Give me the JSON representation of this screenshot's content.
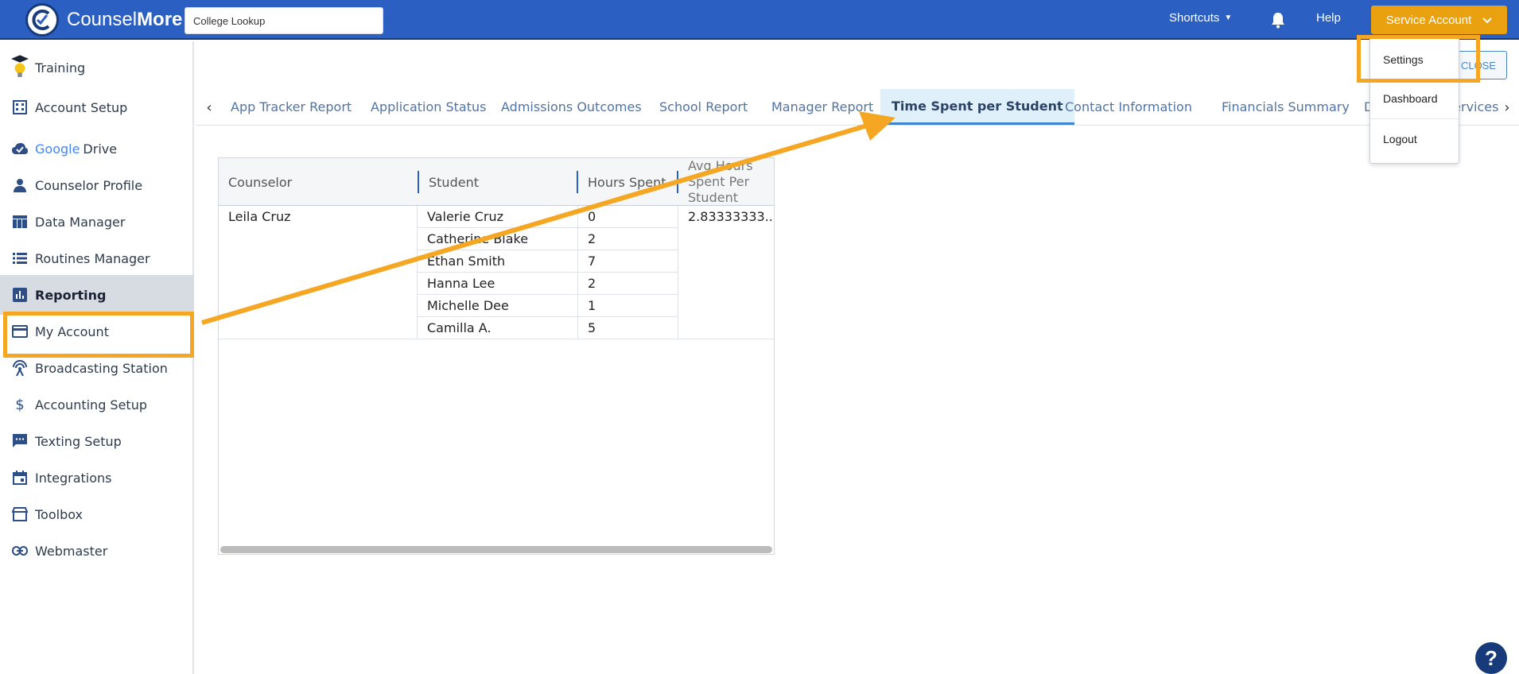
{
  "header": {
    "brand_light": "Counsel",
    "brand_bold": "More",
    "search_value": "College Lookup",
    "shortcuts_label": "Shortcuts",
    "help_label": "Help",
    "account_label": "Service Account"
  },
  "sidebar": {
    "items": [
      {
        "label": "Training"
      },
      {
        "label": "Account Setup"
      },
      {
        "label_google": "Google",
        "label": "Drive"
      },
      {
        "label": "Counselor Profile"
      },
      {
        "label": "Data Manager"
      },
      {
        "label": "Routines Manager"
      },
      {
        "label": "Reporting"
      },
      {
        "label": "My Account"
      },
      {
        "label": "Broadcasting Station"
      },
      {
        "label": "Accounting Setup"
      },
      {
        "label": "Texting Setup"
      },
      {
        "label": "Integrations"
      },
      {
        "label": "Toolbox"
      },
      {
        "label": "Webmaster"
      }
    ]
  },
  "main": {
    "close_label": "CLOSE",
    "tabs": [
      {
        "label": "App Tracker Report"
      },
      {
        "label": "Application Status"
      },
      {
        "label": "Admissions Outcomes"
      },
      {
        "label": "School Report"
      },
      {
        "label": "Manager Report"
      },
      {
        "label": "Time Spent per Student"
      },
      {
        "label": "Contact Information"
      },
      {
        "label": "Financials Summary"
      },
      {
        "label": "Deadlines & Services"
      }
    ],
    "grid": {
      "headers": [
        "Counselor",
        "Student",
        "Hours Spent",
        "Avg Hours Spent Per Student"
      ],
      "counselor": "Leila Cruz",
      "avg": "2.83333333...",
      "rows": [
        {
          "student": "Valerie Cruz",
          "hours": "0"
        },
        {
          "student": "Catherine Blake",
          "hours": "2"
        },
        {
          "student": "Ethan Smith",
          "hours": "7"
        },
        {
          "student": "Hanna Lee",
          "hours": "2"
        },
        {
          "student": "Michelle Dee",
          "hours": "1"
        },
        {
          "student": "Camilla A.",
          "hours": "5"
        }
      ]
    }
  },
  "dropdown": {
    "items": [
      {
        "label": "Settings"
      },
      {
        "label": "Dashboard"
      },
      {
        "label": "Logout"
      }
    ]
  },
  "help_fab": "?",
  "colors": {
    "header_bg": "#2b5fc2",
    "accent_orange": "#f5a623",
    "account_btn": "#e9a10f",
    "active_tab_bg": "#dff0fb"
  }
}
